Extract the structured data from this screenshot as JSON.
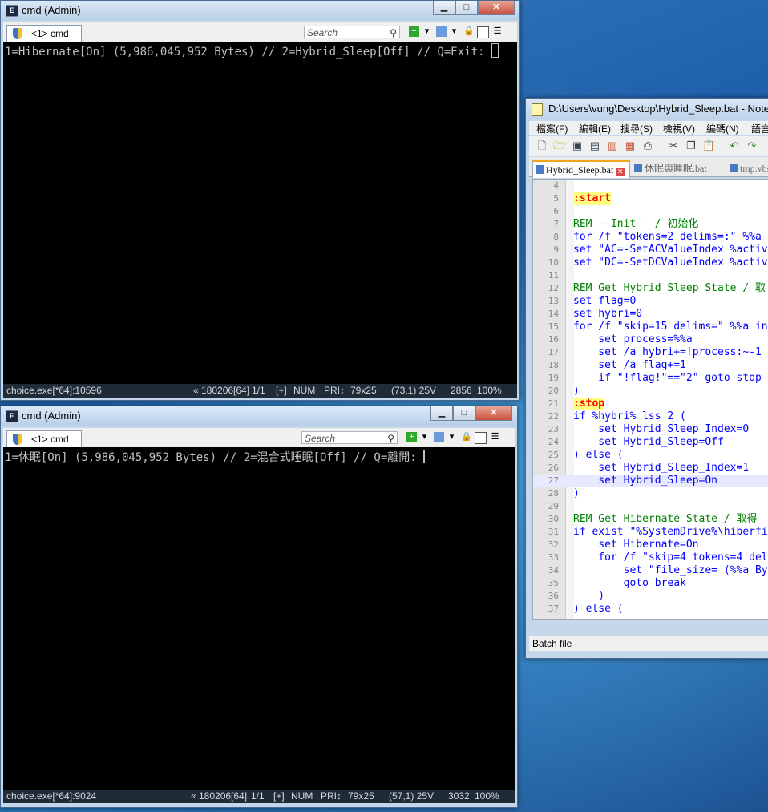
{
  "console1": {
    "title": "cmd (Admin)",
    "tab_label": "<1> cmd",
    "search_placeholder": "Search",
    "output_line": "1=Hibernate[On] (5,986,045,952 Bytes) // 2=Hybrid_Sleep[Off] // Q=Exit: ",
    "status": {
      "process": "choice.exe[*64]:10596",
      "build": "« 180206[64]",
      "console_index": "1/1",
      "plus": "[+]",
      "num": "NUM",
      "pri": "PRI↕",
      "size": "79x25",
      "cursor_pos": "(73,1) 25V",
      "pid": "2856",
      "zoom": "100%"
    }
  },
  "console2": {
    "title": "cmd (Admin)",
    "tab_label": "<1> cmd",
    "search_placeholder": "Search",
    "output_line": "1=休眠[On] (5,986,045,952 Bytes) // 2=混合式睡眠[Off] // Q=離開: ",
    "status": {
      "process": "choice.exe[*64]:9024",
      "build": "« 180206[64]",
      "console_index": "1/1",
      "plus": "[+]",
      "num": "NUM",
      "pri": "PRI↕",
      "size": "79x25",
      "cursor_pos": "(57,1) 25V",
      "pid": "3032",
      "zoom": "100%"
    }
  },
  "notepad": {
    "title": "D:\\Users\\vung\\Desktop\\Hybrid_Sleep.bat - Note",
    "menu": [
      "檔案(F)",
      "編輯(E)",
      "搜尋(S)",
      "檢視(V)",
      "編碼(N)",
      "語言"
    ],
    "tabs": [
      "Hybrid_Sleep.bat",
      "休眠與睡眠.bat",
      "tmp.vbs"
    ],
    "status_text": "Batch file",
    "lines": [
      {
        "n": "4",
        "code": ""
      },
      {
        "n": "5",
        "code": ":start"
      },
      {
        "n": "6",
        "code": ""
      },
      {
        "n": "7",
        "code": "REM --Init-- / 初始化"
      },
      {
        "n": "8",
        "code": "for /f \"tokens=2 delims=:\" %%a"
      },
      {
        "n": "9",
        "code": "set \"AC=-SetACValueIndex %activ"
      },
      {
        "n": "10",
        "code": "set \"DC=-SetDCValueIndex %activ"
      },
      {
        "n": "11",
        "code": ""
      },
      {
        "n": "12",
        "code": "REM Get Hybrid_Sleep State / 取"
      },
      {
        "n": "13",
        "code": "set flag=0"
      },
      {
        "n": "14",
        "code": "set hybri=0"
      },
      {
        "n": "15",
        "code": "for /f \"skip=15 delims=\" %%a in"
      },
      {
        "n": "16",
        "code": "    set process=%%a"
      },
      {
        "n": "17",
        "code": "    set /a hybri+=!process:~-1"
      },
      {
        "n": "18",
        "code": "    set /a flag+=1"
      },
      {
        "n": "19",
        "code": "    if \"!flag!\"==\"2\" goto stop"
      },
      {
        "n": "20",
        "code": ")"
      },
      {
        "n": "21",
        "code": ":stop"
      },
      {
        "n": "22",
        "code": "if %hybri% lss 2 ("
      },
      {
        "n": "23",
        "code": "    set Hybrid_Sleep_Index=0"
      },
      {
        "n": "24",
        "code": "    set Hybrid_Sleep=Off"
      },
      {
        "n": "25",
        "code": ") else ("
      },
      {
        "n": "26",
        "code": "    set Hybrid_Sleep_Index=1"
      },
      {
        "n": "27",
        "code": "    set Hybrid_Sleep=On"
      },
      {
        "n": "28",
        "code": ")"
      },
      {
        "n": "29",
        "code": ""
      },
      {
        "n": "30",
        "code": "REM Get Hibernate State / 取得"
      },
      {
        "n": "31",
        "code": "if exist \"%SystemDrive%\\hiberfi"
      },
      {
        "n": "32",
        "code": "    set Hibernate=On"
      },
      {
        "n": "33",
        "code": "    for /f \"skip=4 tokens=4 del"
      },
      {
        "n": "34",
        "code": "        set \"file_size= (%%a By"
      },
      {
        "n": "35",
        "code": "        goto break"
      },
      {
        "n": "36",
        "code": "    )"
      },
      {
        "n": "37",
        "code": ") else ("
      }
    ],
    "highlight_line": "27"
  }
}
